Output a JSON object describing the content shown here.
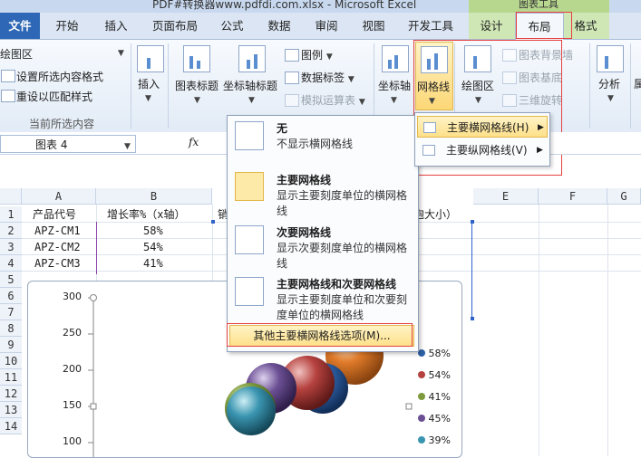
{
  "window": {
    "title": "PDF#转换器www.pdfdi.com.xlsx - Microsoft Excel",
    "context_group": "图表工具"
  },
  "tabs": [
    "文件",
    "开始",
    "插入",
    "页面布局",
    "公式",
    "数据",
    "审阅",
    "视图",
    "开发工具",
    "设计",
    "布局",
    "格式"
  ],
  "ribbon": {
    "current_selection": {
      "dropdown_value": "绘图区",
      "format_selection": "设置所选内容格式",
      "reset_style": "重设以匹配样式",
      "group_label": "当前所选内容"
    },
    "insert": "插入",
    "chart_title": "图表标题",
    "axis_titles": "坐标轴标题",
    "legend": "图例",
    "data_labels": "数据标签",
    "data_table": "模拟运算表",
    "axes": "坐标轴",
    "gridlines": "网格线",
    "plot_area": "绘图区",
    "chart_wall": "图表背景墙",
    "chart_floor": "图表基底",
    "rotation_3d": "三维旋转",
    "analysis": "分析",
    "properties_partial": "属"
  },
  "namebox": {
    "value": "图表 4",
    "fx": "fx"
  },
  "sheet": {
    "columns": [
      "A",
      "B",
      "C",
      "D",
      "E",
      "F",
      "G"
    ],
    "rows": [
      "1",
      "2",
      "3",
      "4",
      "5",
      "6",
      "7",
      "8",
      "9",
      "10",
      "11",
      "12",
      "13",
      "14"
    ],
    "header_row": [
      "产品代号",
      "增长率%（x轴）",
      "销",
      "泡大小）"
    ],
    "data": [
      [
        "APZ-CM1",
        "58%"
      ],
      [
        "APZ-CM2",
        "54%"
      ],
      [
        "APZ-CM3",
        "41%"
      ]
    ]
  },
  "chart_data": {
    "type": "scatter",
    "y_ticks": [
      "300",
      "250",
      "200",
      "150",
      "100"
    ],
    "legend": [
      "58%",
      "54%",
      "41%",
      "45%",
      "39%"
    ],
    "colors": [
      "#2e62a8",
      "#b6423f",
      "#7d9a3c",
      "#6b4f94",
      "#3a95b0"
    ]
  },
  "gridline_menu": {
    "none_title": "无",
    "none_desc": "不显示横网格线",
    "major_title": "主要网格线",
    "major_desc": "显示主要刻度单位的横网格线",
    "minor_title": "次要网格线",
    "minor_desc": "显示次要刻度单位的横网格线",
    "both_title": "主要网格线和次要网格线",
    "both_desc": "显示主要刻度单位和次要刻度单位的横网格线",
    "more_options": "其他主要横网格线选项(M)..."
  },
  "submenu": {
    "horizontal": "主要横网格线(H)",
    "vertical": "主要纵网格线(V)"
  }
}
